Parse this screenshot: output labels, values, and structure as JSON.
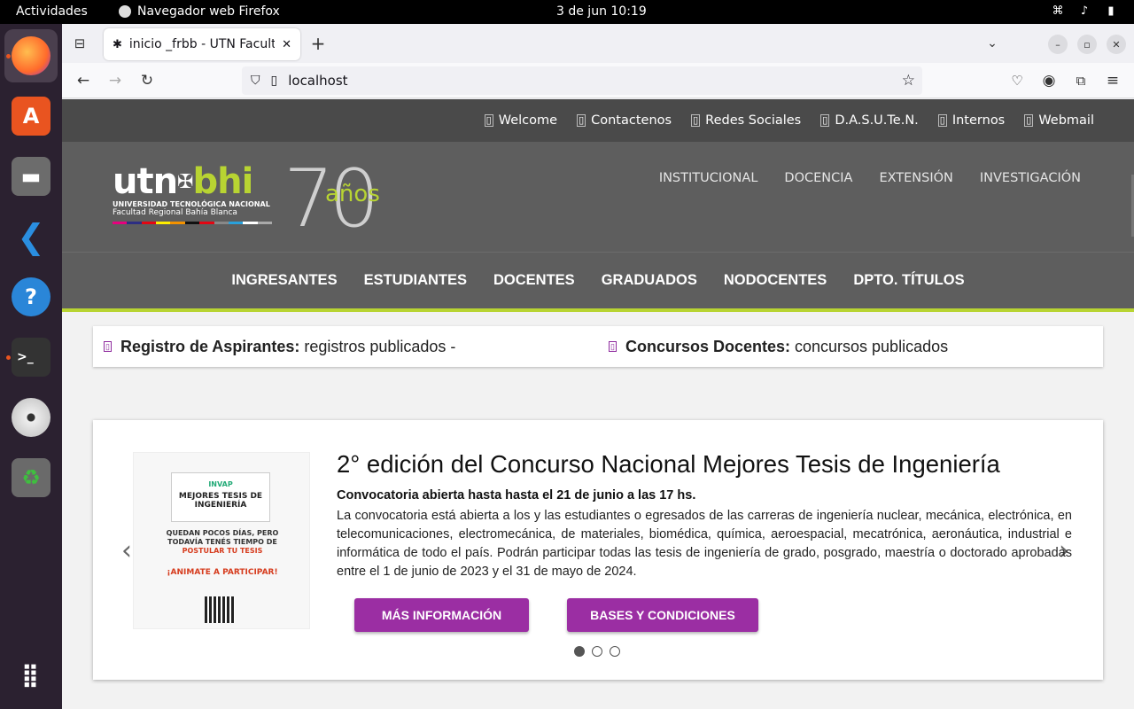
{
  "topbar": {
    "activities": "Actividades",
    "app_name": "Navegador web Firefox",
    "clock": "3 de jun  10:19"
  },
  "dock": {
    "items": [
      "firefox",
      "ubuntu-software",
      "files",
      "vscode",
      "help",
      "terminal",
      "dvd",
      "trash",
      "apps-grid"
    ]
  },
  "browser": {
    "tab_title": "inicio _frbb - UTN Facultad Regional Bahía Blanca",
    "url": "localhost"
  },
  "site": {
    "util_links": [
      "Welcome",
      "Contactenos",
      "Redes Sociales",
      "D.A.S.U.Te.N.",
      "Internos",
      "Webmail"
    ],
    "logo": {
      "utn": "utn",
      "bhi": "bhi",
      "line1": "UNIVERSIDAD TECNOLÓGICA NACIONAL",
      "line2": "Facultad Regional Bahía Blanca",
      "seventy": "70",
      "anos": "años"
    },
    "main_nav": [
      "INSTITUCIONAL",
      "DOCENCIA",
      "EXTENSIÓN",
      "INVESTIGACIÓN"
    ],
    "sec_nav": [
      "INGRESANTES",
      "ESTUDIANTES",
      "DOCENTES",
      "GRADUADOS",
      "NODOCENTES",
      "DPTO. TÍTULOS"
    ],
    "ticker": [
      {
        "bold": "Registro de Aspirantes:",
        "text": " registros publicados -"
      },
      {
        "bold": "Concursos Docentes:",
        "text": " concursos publicados"
      }
    ],
    "slide": {
      "title": "2° edición del Concurso Nacional Mejores Tesis de Ingeniería",
      "subtitle": "Convocatoria abierta hasta hasta el 21 de junio a las 17 hs.",
      "body": "La convocatoria está abierta a los y las estudiantes o egresados de las carreras de ingeniería nuclear, mecánica, electrónica, en telecomunicaciones, electromecánica, de materiales, biomédica, química, aeroespacial, mecatrónica, aeronáutica, industrial e informática de todo el país. Podrán participar todas las tesis de ingeniería de grado, posgrado, maestría o doctorado aprobadas entre el 1 de junio de 2023 y el 31 de mayo de 2024.",
      "btn1": "MÁS INFORMACIÓN",
      "btn2": "BASES Y CONDICIONES",
      "poster": {
        "head1": "INVAP",
        "head2": "MEJORES TESIS DE INGENIERÍA",
        "t1": "QUEDAN POCOS DÍAS, PERO TODAVÍA TENÉS TIEMPO DE",
        "t2": "POSTULAR TU TESIS",
        "t3": "¡ANIMATE A PARTICIPAR!"
      }
    }
  },
  "colors": {
    "accent_green": "#b8d432",
    "accent_purple": "#9b2ea3",
    "header_gray": "#5e5e5e"
  }
}
